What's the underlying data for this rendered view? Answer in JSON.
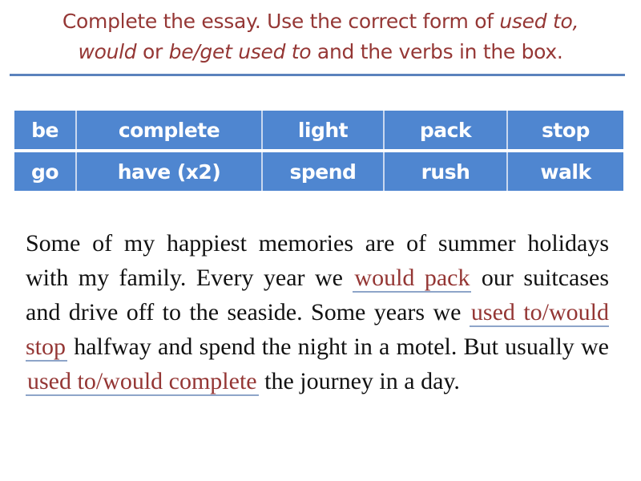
{
  "instruction": {
    "part1": "Complete the essay. Use the correct form of ",
    "italic1": "used to,",
    "line2_italic": "would",
    "part2": " or ",
    "italic2": "be/get used to",
    "part3": " and the verbs in the box."
  },
  "verb_box": {
    "rows": [
      [
        "be",
        "complete",
        "light",
        "pack",
        "stop"
      ],
      [
        "go",
        "have (x2)",
        "spend",
        "rush",
        "walk"
      ]
    ]
  },
  "essay": {
    "text1": "Some of my happiest memories are of summer holidays with my family. Every year we ",
    "answer1": "would pack",
    "text2": " our suitcases and drive off to the seaside. Some years we ",
    "answer2": "used to/would stop",
    "text3": " halfway and spend the night in a motel. But usually we ",
    "answer3": "used to/would complete",
    "text4": " the journey in a day."
  },
  "colors": {
    "title": "#953735",
    "table_bg": "#4f86d0",
    "answer": "#943634",
    "rule": "#5b82bd"
  }
}
